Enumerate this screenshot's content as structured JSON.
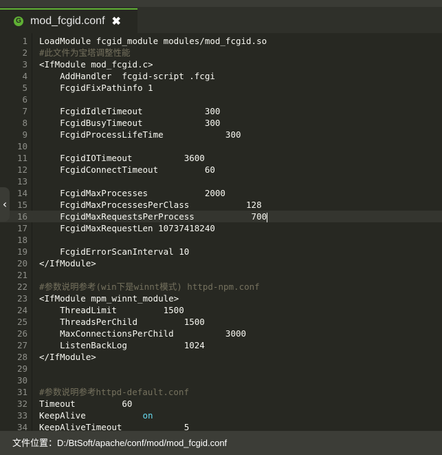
{
  "tab": {
    "icon_glyph": "G",
    "title": "mod_fcgid.conf",
    "close_glyph": "✖"
  },
  "editor": {
    "lines": [
      {
        "n": "1",
        "text": "LoadModule fcgid_module modules/mod_fcgid.so",
        "type": "code"
      },
      {
        "n": "2",
        "text": "#此文件为宝塔调整性能",
        "type": "comment"
      },
      {
        "n": "3",
        "text": "<IfModule mod_fcgid.c>",
        "type": "code"
      },
      {
        "n": "4",
        "text": "    AddHandler  fcgid-script .fcgi",
        "type": "code"
      },
      {
        "n": "5",
        "text": "    FcgidFixPathinfo 1",
        "type": "code"
      },
      {
        "n": "6",
        "text": "",
        "type": "code"
      },
      {
        "n": "7",
        "text": "    FcgidIdleTimeout            300",
        "type": "code"
      },
      {
        "n": "8",
        "text": "    FcgidBusyTimeout            300",
        "type": "code"
      },
      {
        "n": "9",
        "text": "    FcgidProcessLifeTime            300",
        "type": "code"
      },
      {
        "n": "10",
        "text": "",
        "type": "code"
      },
      {
        "n": "11",
        "text": "    FcgidIOTimeout          3600",
        "type": "code"
      },
      {
        "n": "12",
        "text": "    FcgidConnectTimeout         60",
        "type": "code"
      },
      {
        "n": "13",
        "text": "",
        "type": "code"
      },
      {
        "n": "14",
        "text": "    FcgidMaxProcesses           2000",
        "type": "code"
      },
      {
        "n": "15",
        "text": "    FcgidMaxProcessesPerClass           128",
        "type": "code"
      },
      {
        "n": "16",
        "text": "    FcgidMaxRequestsPerProcess           700",
        "type": "code",
        "current": true
      },
      {
        "n": "17",
        "text": "    FcgidMaxRequestLen 10737418240",
        "type": "code"
      },
      {
        "n": "18",
        "text": "",
        "type": "code"
      },
      {
        "n": "19",
        "text": "    FcgidErrorScanInterval 10",
        "type": "code"
      },
      {
        "n": "20",
        "text": "</IfModule>",
        "type": "code"
      },
      {
        "n": "21",
        "text": "",
        "type": "code"
      },
      {
        "n": "22",
        "text": "#参数说明参考(win下是winnt模式) httpd-npm.conf",
        "type": "comment"
      },
      {
        "n": "23",
        "text": "<IfModule mpm_winnt_module>",
        "type": "code"
      },
      {
        "n": "24",
        "text": "    ThreadLimit         1500",
        "type": "code"
      },
      {
        "n": "25",
        "text": "    ThreadsPerChild         1500",
        "type": "code"
      },
      {
        "n": "26",
        "text": "    MaxConnectionsPerChild          3000",
        "type": "code"
      },
      {
        "n": "27",
        "text": "    ListenBackLog           1024",
        "type": "code"
      },
      {
        "n": "28",
        "text": "</IfModule>",
        "type": "code"
      },
      {
        "n": "29",
        "text": "",
        "type": "code"
      },
      {
        "n": "30",
        "text": "",
        "type": "code"
      },
      {
        "n": "31",
        "text": "#参数说明参考httpd-default.conf",
        "type": "comment"
      },
      {
        "n": "32",
        "text": "Timeout         60",
        "type": "code"
      },
      {
        "n": "33",
        "text": "KeepAlive           ",
        "keyword": "on",
        "type": "code"
      },
      {
        "n": "34",
        "text": "KeepAliveTimeout            5",
        "type": "code"
      }
    ]
  },
  "sidebar_toggle": {
    "glyph": "‹"
  },
  "status": {
    "label": "文件位置：",
    "path": "D:/BtSoft/apache/conf/mod/mod_fcgid.conf"
  }
}
